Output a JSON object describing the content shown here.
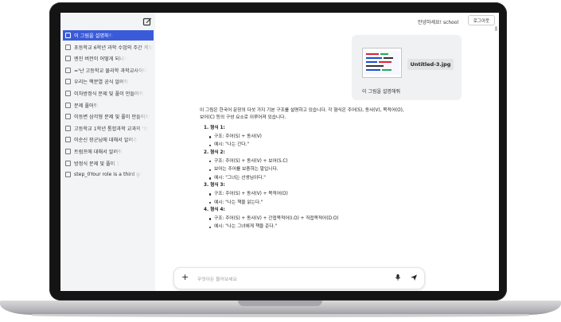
{
  "header": {
    "greeting": "안녕하세요!",
    "username": "school",
    "login_label": "로그아웃"
  },
  "sidebar": {
    "items": [
      {
        "label": "이 그림을 설명해줘",
        "active": true
      },
      {
        "label": "초등학교 6학년 과학 수업의 주간 계획",
        "active": false
      },
      {
        "label": "엔진 버전이 어떻게 되니?",
        "active": false
      },
      {
        "label": "='난 고등학교 물리학 과학교사이다",
        "active": false
      },
      {
        "label": "우리는 핵분열 공식 알려줘",
        "active": false
      },
      {
        "label": "이차방정식 문제 및 풀이 만들어줘",
        "active": false
      },
      {
        "label": "문제 풀어줘",
        "active": false
      },
      {
        "label": "이등변 삼각형 문제 및 풀이 만들어줘",
        "active": false
      },
      {
        "label": "고등학교 1학년 통합과학 교과의 '생",
        "active": false
      },
      {
        "label": "이순신 장군님에 대해서 알려주",
        "active": false
      },
      {
        "label": "트럼프에 대해서 알려줘",
        "active": false
      },
      {
        "label": "방정식 문제 및 풀이 1",
        "active": false
      },
      {
        "label": "step_0Your role is a third gr",
        "active": false
      }
    ]
  },
  "attachment": {
    "file_name": "Untitled-3.jpg",
    "caption": "이 그림을 설명해줘"
  },
  "answer": {
    "intro_line1": "이 그림은 한국어 문장의 다섯 가지 기본 구조를 설명하고 있습니다. 각 형식은 주어(S), 동사(V), 목적어(O),",
    "intro_line2": "보어(C) 등의 구성 요소로 이루어져 있습니다.",
    "sections": [
      {
        "title": "1. 형식 1:",
        "bullets": [
          "구조: 주어(S) + 동사(V)",
          "예시: \"나는 간다.\""
        ]
      },
      {
        "title": "2. 형식 2:",
        "bullets": [
          "구조: 주어(S) + 동사(V) + 보어(S.C)",
          "보어는 주어를 보충하는 말입니다.",
          "예시: \"그녀는 선생님이다.\""
        ]
      },
      {
        "title": "3. 형식 3:",
        "bullets": [
          "구조: 주어(S) + 동사(V) + 목적어(O)",
          "예시: \"나는 책을 읽는다.\""
        ]
      },
      {
        "title": "4. 형식 4:",
        "bullets": [
          "구조: 주어(S) + 동사(V) + 간접목적어(I.O) + 직접목적어(D.O)",
          "예시: \"나는 그녀에게 책을 준다.\""
        ]
      }
    ]
  },
  "input": {
    "placeholder": "무엇이든 물어보세요"
  },
  "icons": {
    "new_chat": "edit-icon",
    "add": "plus-icon",
    "voice": "mic-icon",
    "send": "send-icon"
  }
}
